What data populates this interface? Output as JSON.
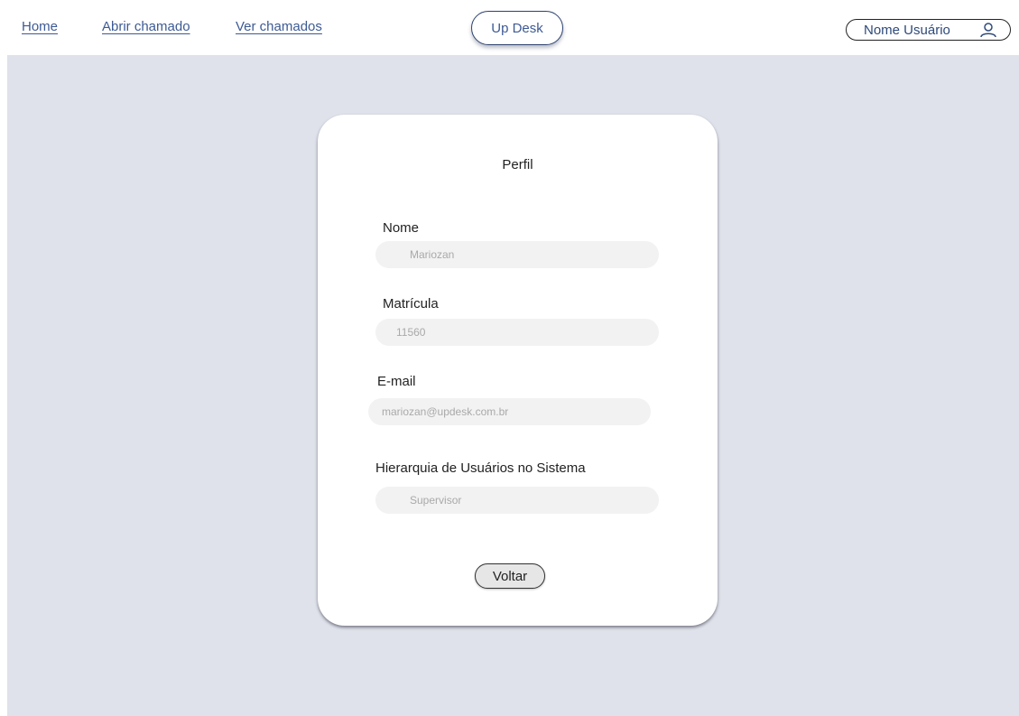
{
  "nav": {
    "home": "Home",
    "abrir_chamado": "Abrir chamado",
    "ver_chamados": "Ver chamados"
  },
  "brand": "Up Desk",
  "user": {
    "name": "Nome Usuário",
    "icon": "user-icon"
  },
  "profile": {
    "title": "Perfil",
    "fields": {
      "nome": {
        "label": "Nome",
        "value": "Mariozan"
      },
      "matricula": {
        "label": "Matrícula",
        "value": "11560"
      },
      "email": {
        "label": "E-mail",
        "value": "mariozan@updesk.com.br"
      },
      "hierarquia": {
        "label": "Hierarquia de Usuários no Sistema",
        "value": "Supervisor"
      }
    },
    "back_button": "Voltar"
  },
  "colors": {
    "link": "#3d5a94",
    "background": "#dfe2ea",
    "card": "#ffffff",
    "input": "#f2f2f2"
  }
}
